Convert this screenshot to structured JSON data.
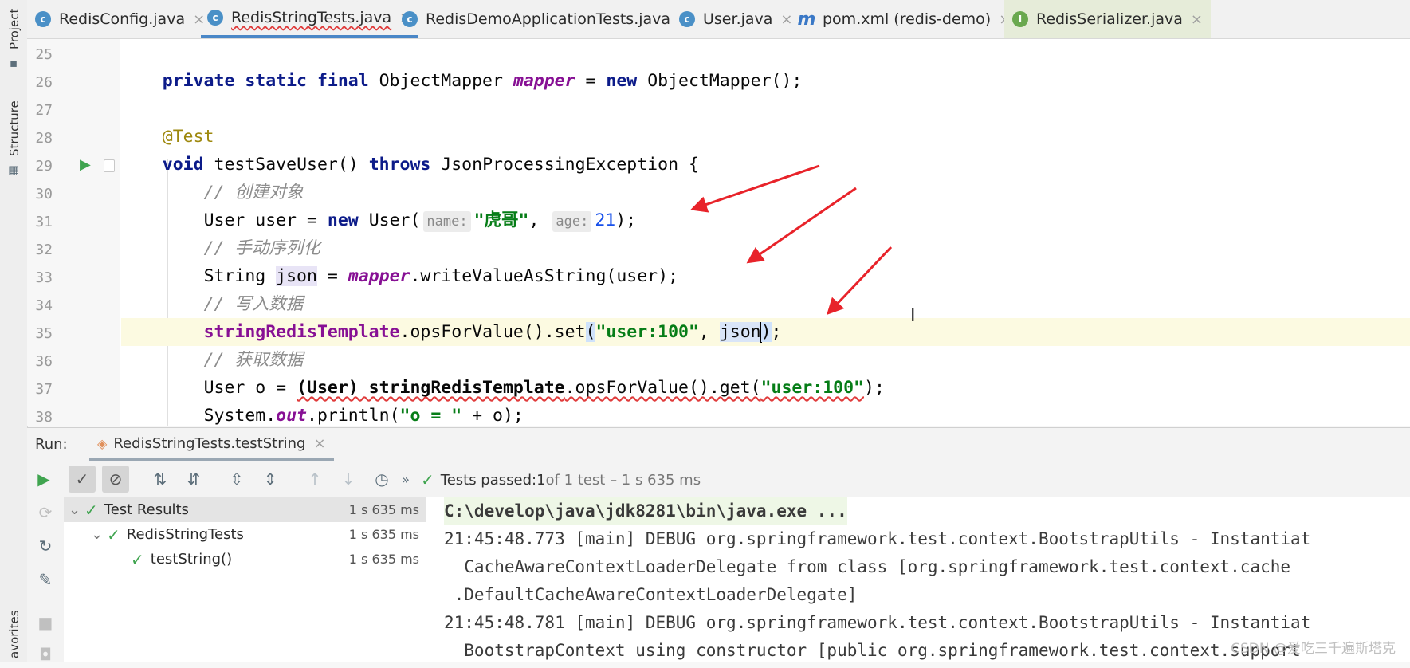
{
  "left_strip": {
    "project_label": "Project",
    "structure_label": "Structure",
    "favorites_label": "avorites"
  },
  "tabs": [
    {
      "label": "RedisConfig.java",
      "icon": "class-icon",
      "icon_letter": "c",
      "active": false
    },
    {
      "label": "RedisStringTests.java",
      "icon": "test-class-icon",
      "icon_letter": "c",
      "active": true
    },
    {
      "label": "RedisDemoApplicationTests.java",
      "icon": "test-class-icon",
      "icon_letter": "c",
      "active": false
    },
    {
      "label": "User.java",
      "icon": "class-icon",
      "icon_letter": "c",
      "active": false
    },
    {
      "label": "pom.xml (redis-demo)",
      "icon": "maven-icon",
      "icon_letter": "m",
      "active": false
    },
    {
      "label": "RedisSerializer.java",
      "icon": "interface-icon",
      "icon_letter": "I",
      "active": false
    }
  ],
  "editor": {
    "line_numbers": [
      "25",
      "26",
      "27",
      "28",
      "29",
      "30",
      "31",
      "32",
      "33",
      "34",
      "35",
      "36",
      "37",
      "38"
    ],
    "code": {
      "l26_a": "private static final ",
      "l26_b": "ObjectMapper ",
      "l26_c": "mapper",
      "l26_d": " = ",
      "l26_e": "new ",
      "l26_f": "ObjectMapper();",
      "l28": "@Test",
      "l29_a": "void ",
      "l29_b": "testSaveUser() ",
      "l29_c": "throws ",
      "l29_d": "JsonProcessingException {",
      "l30": "// 创建对象",
      "l31_a": "User user = ",
      "l31_b": "new ",
      "l31_c": "User(",
      "l31_hint1": "name:",
      "l31_d": "\"虎哥\"",
      "l31_e": ", ",
      "l31_hint2": "age:",
      "l31_f": "21",
      "l31_g": ");",
      "l32": "// 手动序列化",
      "l33_a": "String ",
      "l33_b": "json",
      "l33_c": " = ",
      "l33_d": "mapper",
      "l33_e": ".writeValueAsString(user);",
      "l34": "// 写入数据",
      "l35_a": "stringRedisTemplate",
      "l35_b": ".opsForValue().set",
      "l35_c": "(",
      "l35_d": "\"user:100\"",
      "l35_e": ", ",
      "l35_f": "json",
      "l35_g": ")",
      "l35_h": ";",
      "l36": "// 获取数据",
      "l37_a": "User o = ",
      "l37_b": "(User) stringRedisTemplate",
      "l37_c": ".opsForValue().get(",
      "l37_d": "\"user:100\"",
      "l37_e": ");",
      "l38_a": "System.",
      "l38_b": "out",
      "l38_c": ".println(",
      "l38_d": "\"o = \"",
      "l38_e": " + o);"
    }
  },
  "run_panel": {
    "run_label": "Run:",
    "run_tab_label": "RedisStringTests.testString",
    "status_prefix": "Tests passed: ",
    "status_count": "1",
    "status_suffix": " of 1 test – 1 s 635 ms",
    "tree": [
      {
        "label": "Test Results",
        "duration": "1 s 635 ms",
        "level": 0
      },
      {
        "label": "RedisStringTests",
        "duration": "1 s 635 ms",
        "level": 1
      },
      {
        "label": "testString()",
        "duration": "1 s 635 ms",
        "level": 2
      }
    ],
    "console": [
      "C:\\develop\\java\\jdk8281\\bin\\java.exe ...",
      "21:45:48.773 [main] DEBUG org.springframework.test.context.BootstrapUtils - Instantiat",
      "  CacheAwareContextLoaderDelegate from class [org.springframework.test.context.cache",
      " .DefaultCacheAwareContextLoaderDelegate]",
      "21:45:48.781 [main] DEBUG org.springframework.test.context.BootstrapUtils - Instantiat",
      "  BootstrapContext using constructor [public org.springframework.test.context.support"
    ],
    "watermark": "CSDN @爱吃三千遍斯塔克"
  },
  "colors": {
    "accent": "#4a87c7",
    "pass_green": "#3fa44f",
    "keyword": "#0c1b89",
    "field": "#871094",
    "string": "#067d17",
    "arrow": "#e8232a"
  }
}
